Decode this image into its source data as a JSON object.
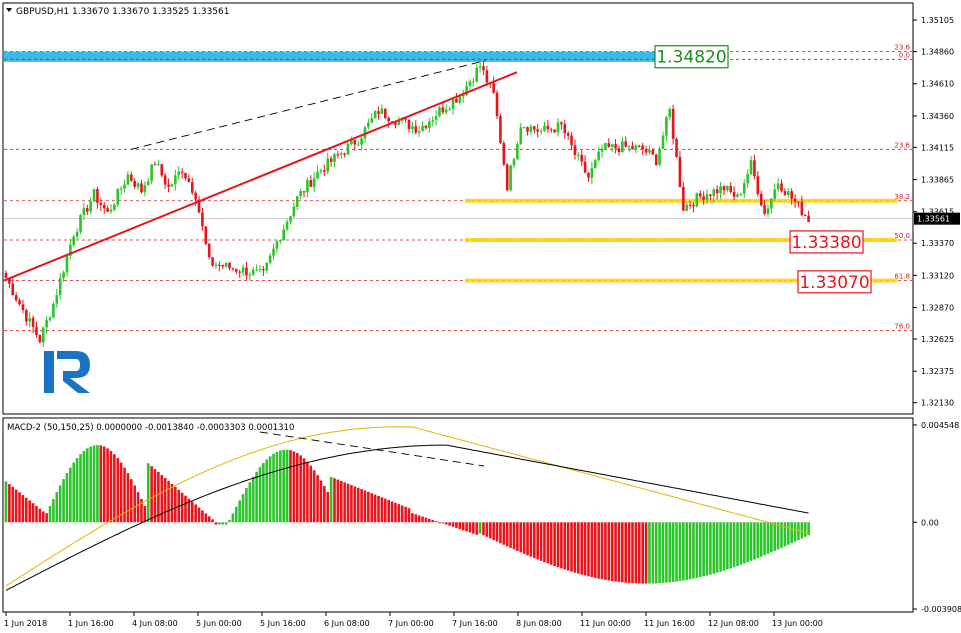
{
  "header": {
    "symbol_info": "GBPUSD,H1  1.33670 1.33670 1.33525 1.33561"
  },
  "macd_header": {
    "label": "MACD-2 (50,150,25) 0.0000000 -0.0013840 -0.0003303 0.0001310"
  },
  "logo": {
    "name": "roboforex-logo",
    "letter": "R"
  },
  "colors": {
    "bull": "#2bc42b",
    "bear": "#e8141c",
    "trendline": "#e8141c",
    "fib_line": "#d21e1e",
    "level_highlight": "#ffd000",
    "resistance_band": "#22b4e6",
    "label_green": "#1e8c1e",
    "label_red": "#e8141c",
    "macd_signal_black": "#000000",
    "macd_signal_yellow": "#e6b400"
  },
  "chart_data": [
    {
      "type": "candlestick",
      "name_label": "GBPUSD,H1",
      "ylim": [
        1.3205,
        1.3523
      ],
      "y_ticks": [
        "1.35105",
        "1.34860",
        "1.34610",
        "1.34360",
        "1.34115",
        "1.33865",
        "1.33615",
        "1.33370",
        "1.33120",
        "1.32870",
        "1.32625",
        "1.32375",
        "1.32130"
      ],
      "current_price": "1.33561",
      "candles": [],
      "fib_levels": [
        {
          "label": "23.6",
          "price": 1.3486
        },
        {
          "label": "0.0",
          "price": 1.348
        },
        {
          "label": "23.6",
          "price": 1.341
        },
        {
          "label": "38.2",
          "price": 1.337
        },
        {
          "label": "50.0",
          "price": 1.33395
        },
        {
          "label": "61.8",
          "price": 1.3308
        },
        {
          "label": "76.0",
          "price": 1.3269
        }
      ],
      "annotations": [
        {
          "label": "1.34820",
          "price": 1.3482,
          "style": "green"
        },
        {
          "label": "1.33380",
          "price": 1.3338,
          "style": "red"
        },
        {
          "label": "1.33070",
          "price": 1.3307,
          "style": "red"
        }
      ],
      "resistance_band": [
        1.3478,
        1.3486
      ],
      "highlighted_levels": [
        1.337,
        1.33395,
        1.3308
      ],
      "trendline": [
        {
          "t": 0,
          "price": 1.3308
        },
        {
          "t": 0.565,
          "price": 1.347
        }
      ],
      "dashed_line": [
        {
          "t": 0.14,
          "price": 1.341
        },
        {
          "t": 0.53,
          "price": 1.3479
        }
      ]
    },
    {
      "type": "bar",
      "name_label": "MACD-2 (50,150,25)",
      "ylim": [
        -0.003908,
        0.004548
      ],
      "y_ticks": [
        "0.004548",
        "0.00",
        "-0.003908"
      ],
      "values": [],
      "signal_black": [],
      "signal_yellow": []
    }
  ],
  "time_axis": {
    "labels": [
      "1 Jun 2018",
      "1 Jun 16:00",
      "4 Jun 08:00",
      "5 Jun 00:00",
      "5 Jun 16:00",
      "6 Jun 08:00",
      "7 Jun 00:00",
      "7 Jun 16:00",
      "8 Jun 08:00",
      "11 Jun 00:00",
      "11 Jun 16:00",
      "12 Jun 08:00",
      "13 Jun 00:00"
    ]
  }
}
